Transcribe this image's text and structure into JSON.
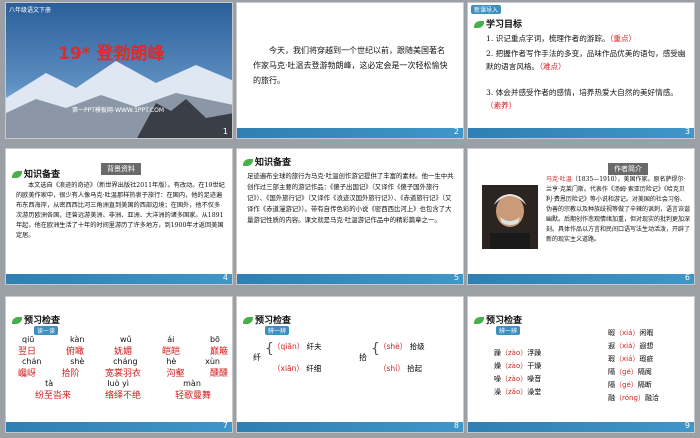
{
  "slide1": {
    "grade_label": "八年级语文下册",
    "title": "19* 登勃朗峰",
    "watermark": "第一PPT模板网-WWW.1PPT.COM",
    "num": "1"
  },
  "slide2": {
    "text": "今天，我们将穿越到一个世纪以前，跟随美国著名作家马克·吐温去登游勃朗峰，这必定会是一次轻松愉快的旅行。",
    "num": "2"
  },
  "slide3": {
    "badge": "新课导入",
    "heading": "学习目标",
    "g1": "1. 识记重点字词，梳理作者的游踪。",
    "g1_tag": "（重点）",
    "g2": "2. 把握作者写作手法的多变，品味作品优美的语句，感受幽默的语言风格。",
    "g2_tag": "（难点）",
    "g3": "3. 体会并感受作者的感情，培养热爱大自然的美好情感。",
    "g3_tag": "（素养）",
    "num": "3"
  },
  "slide4": {
    "heading": "知识备查",
    "banner": "背景资料",
    "text": "本文选自《浪迹的奇迹》（新世界出版社2011年版）。有改动。在19世纪的欧美作家中，很少有人像马克·吐温那样热衷于旅行：在国内，他的足迹遍布东西海岸，从密西西比河三角洲直到美国的西部边境；在国外，他不仅多次游历欧洲各国，还曾远游美洲、非洲、亚洲、大洋洲的诸多国家。从1891年起，他在欧洲生活了十年的时间里游历了许多地方，到1900年才返回美国定居。",
    "num": "4"
  },
  "slide5": {
    "heading": "知识备查",
    "text": "足迹遍布全球的旅行为马克·吐温创作游记提供了丰富的素材。他一生中共创作过三部主要的游记作品：《傻子出国记》（又译作《傻子国外旅行记》）、《国外旅行记》（又译作《浪迹汉国外旅行记》）、《赤道旅行记》（又译作《赤道漫游记》）。带有自传色彩的小说《密西西比河上》也包含了大量游记性质的内容。课文就是马克·吐温游记作品中的精彩篇章之一。",
    "num": "5"
  },
  "slide6": {
    "banner": "作者简介",
    "name": "马克·吐温",
    "intro": "（1835—1910），美国作家。原名萨缪尔·兰亨·克莱门斯。代表作《汤姆·索亚历险记》《哈克贝利·费恩历险记》等小说和游记。对美国的社会习俗、伪善的宗教以及种族歧视等做了辛辣的讽刺，语言诙谐幽默。后期创作悲观情绪加重，但对现实的批判更加深刻。具体作品以方言和民间口语写法生动活泼，开辟了新的现实主义道路。",
    "num": "6"
  },
  "slide7": {
    "heading": "预习检查",
    "badge": "读一读",
    "row1_py": [
      "qiū",
      "kàn",
      "wǔ",
      "ái",
      "bō"
    ],
    "row1_hz": [
      "翌日",
      "俯瞰",
      "妩媚",
      "皑皑",
      "巅簸"
    ],
    "row2_py": [
      "chán",
      "shè",
      "cháng",
      "hè",
      "xùn"
    ],
    "row2_hz": [
      "巉岈",
      "拾阶",
      "宽裳羽衣",
      "沟壑",
      "醺醺"
    ],
    "row3_py": [
      "tà",
      "luò yì",
      "màn"
    ],
    "row3_hz": [
      "纷至沓来",
      "络绎不绝",
      "轻歌曼舞"
    ],
    "num": "7"
  },
  "slide8": {
    "heading": "预习检查",
    "badge": "辨一辨",
    "g1_char": "纤",
    "g1_a_py": "（qiān）",
    "g1_a_word": "纤夫",
    "g1_b_py": "（xiān）",
    "g1_b_word": "纤细",
    "g2_char": "拾",
    "g2_a_py": "（shè）",
    "g2_a_word": "拾级",
    "g2_b_py": "（shí）",
    "g2_b_word": "拾起",
    "num": "8"
  },
  "slide9": {
    "heading": "预习检查",
    "badge": "辨一辨",
    "left": [
      {
        "char": "躁",
        "py": "（zào）",
        "word": "浮躁"
      },
      {
        "char": "燥",
        "py": "（zào）",
        "word": "干燥"
      },
      {
        "char": "噪",
        "py": "（zào）",
        "word": "噪音"
      },
      {
        "char": "澡",
        "py": "（zǎo）",
        "word": "澡堂"
      }
    ],
    "right": [
      {
        "char": "暇",
        "py": "（xiá）",
        "word": "闲暇"
      },
      {
        "char": "遐",
        "py": "（xiá）",
        "word": "遐想"
      },
      {
        "char": "瑕",
        "py": "（xiá）",
        "word": "瑕疵"
      },
      {
        "char": "隔",
        "py": "（gé）",
        "word": "隔阂"
      },
      {
        "char": "隔",
        "py": "（gé）",
        "word": "隔断"
      },
      {
        "char": "融",
        "py": "（róng）",
        "word": "融洽"
      }
    ],
    "num": "9"
  }
}
